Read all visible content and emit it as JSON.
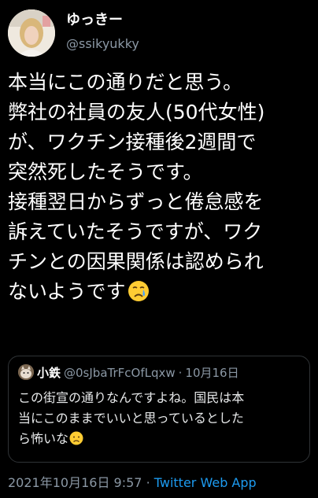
{
  "author": {
    "display_name": "ゆっきー",
    "handle": "@ssikyukky",
    "avatar_icon": "profile-photo-avatar"
  },
  "tweet": {
    "lines": [
      "本当にこの通りだと思う。",
      "弊社の社員の友人(50代女性)",
      "が、ワクチン接種後2週間で",
      "突然死したそうです。",
      "接種翌日からずっと倦怠感を",
      "訴えていたそうですが、ワク",
      "チンとの因果関係は認められ",
      "ないようです"
    ],
    "trailing_emoji": "crying-face-emoji"
  },
  "quote": {
    "name": "小鉄",
    "handle": "@0sJbaTrFcOfLqxw",
    "separator": "·",
    "date": "10月16日",
    "lines": [
      "この街宣の通りなんですよね。国民は本",
      "当にこのままでいいと思っているとした",
      "ら怖いな"
    ],
    "trailing_emoji": "worried-face-emoji"
  },
  "footer": {
    "timestamp": "2021年10月16日 9:57",
    "separator": "·",
    "app": "Twitter Web App"
  },
  "colors": {
    "background": "#000000",
    "text": "#ffffff",
    "muted": "#8b98a5",
    "link": "#1d9bf0",
    "border": "#2f3336"
  }
}
